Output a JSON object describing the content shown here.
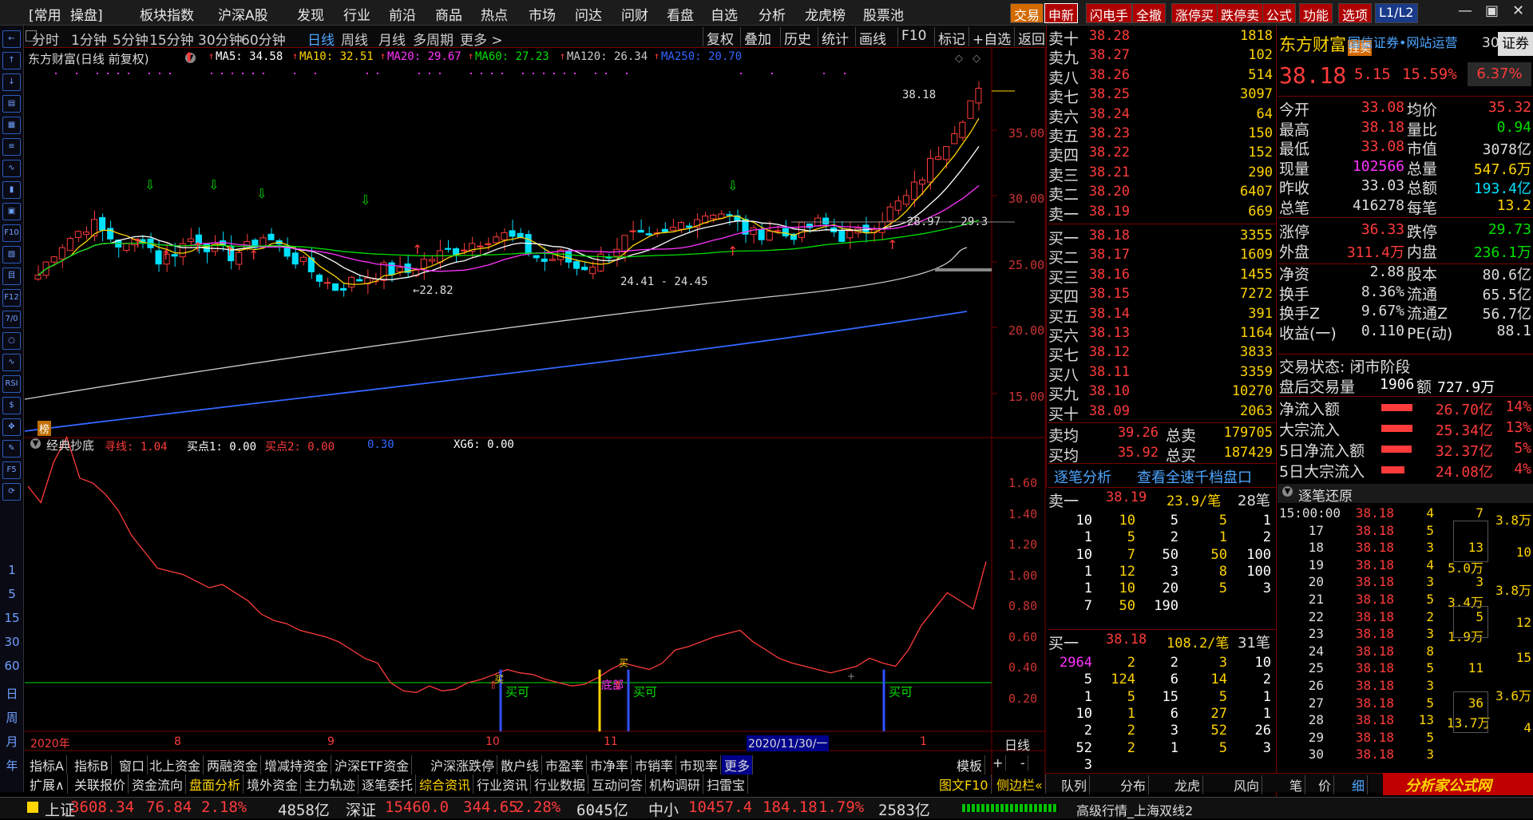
{
  "colors": {
    "up": "#ff3b3b",
    "down": "#00e0ff",
    "green": "#00e000",
    "yellow": "#ffd400",
    "magenta": "#ff33ff",
    "grid": "#7a0000"
  },
  "menu": {
    "items": [
      "[常用",
      "操盘]",
      "板块指数",
      "沪深A股",
      "发现",
      "行业",
      "前沿",
      "商品",
      "热点",
      "市场",
      "问达",
      "问财",
      "看盘",
      "自选",
      "分析",
      "龙虎榜",
      "股票池"
    ],
    "right_buttons": [
      "交易",
      "申新",
      "闪电手",
      "全撤",
      "涨停买",
      "跌停卖",
      "公式",
      "功能",
      "选项",
      "L1/L2"
    ]
  },
  "window_controls": [
    "—",
    "▣",
    "✕"
  ],
  "sidebar": {
    "icons": [
      "arrow-left-icon",
      "arrow-up-icon",
      "arrow-down-icon",
      "chart-icon",
      "grid-icon",
      "list-icon",
      "line-chart-icon",
      "candle-icon",
      "board-icon",
      "f10-icon",
      "doc-icon",
      "quote-icon",
      "f12-icon",
      "f6-icon",
      "circle-icon",
      "wave-icon",
      "rsi-icon",
      "money-icon",
      "move-icon",
      "pencil-icon",
      "f5-icon",
      "refresh-icon"
    ],
    "icon_labels": [
      "←",
      "↑",
      "↓",
      "▤",
      "▦",
      "≡",
      "∿",
      "▮",
      "▣",
      "F10",
      "▧",
      "目",
      "F12",
      "7/0",
      "○",
      "∿",
      "RSI",
      "$",
      "✥",
      "✎",
      "F5",
      "⟳"
    ],
    "numbers": [
      "1",
      "5",
      "15",
      "30",
      "60",
      "日",
      "周",
      "月",
      "年"
    ]
  },
  "toolbar": {
    "periods": [
      "分时",
      "1分钟",
      "5分钟",
      "15分钟",
      "30分钟",
      "60分钟",
      "日线",
      "周线",
      "月线",
      "多周期",
      "更多 >"
    ],
    "active": "日线",
    "tools": [
      "复权",
      "叠加",
      "历史",
      "统计",
      "画线",
      "F10",
      "标记",
      "+自选",
      "返回"
    ]
  },
  "stock": {
    "title": "东方财富(日线 前复权)",
    "name": "东方财富",
    "price": "38.18",
    "change": "5.15",
    "pct": "15.59%",
    "right_pct": "6.37%",
    "badge": "挂卖",
    "broker": "国信证券•网站运营",
    "code_prefix": "30",
    "tag": "证券",
    "rank_badge": "榜"
  },
  "ma_legend": [
    {
      "label": "MA5: 34.58",
      "color": "#ffffff"
    },
    {
      "label": "MA10: 32.51",
      "color": "#ffd400"
    },
    {
      "label": "MA20: 29.67",
      "color": "#ff33ff"
    },
    {
      "label": "MA60: 27.23",
      "color": "#00e000"
    },
    {
      "label": "MA120: 26.34",
      "color": "#cccccc"
    },
    {
      "label": "MA250: 20.70",
      "color": "#3366ff"
    }
  ],
  "price_axis": [
    "35.00",
    "30.00",
    "25.00",
    "20.00",
    "15.00"
  ],
  "annotations": {
    "high": "38.18",
    "range": "28.97 - 29.3",
    "low1": "←22.82",
    "low2": "24.41 - 24.45"
  },
  "indicator": {
    "name": "经典抄底",
    "legend": [
      {
        "label": "寻线: 1.04",
        "color": "#ff3b3b"
      },
      {
        "label": "买点1: 0.00",
        "color": "#ffffff"
      },
      {
        "label": "买点2: 0.00",
        "color": "#ff3b3b"
      },
      {
        "label": "0.30",
        "color": "#3366ff"
      },
      {
        "label": "XG6: 0.00",
        "color": "#ffffff"
      }
    ],
    "axis": [
      "1.60",
      "1.40",
      "1.20",
      "1.00",
      "0.80",
      "0.60",
      "0.40",
      "0.20"
    ],
    "signal": "买可",
    "signal2": "底部",
    "mark": "买"
  },
  "date_axis": {
    "labels": [
      "2020年",
      "8",
      "9",
      "10",
      "11",
      "2020/11/30/一",
      "1"
    ],
    "period": "日线"
  },
  "bottom_tabs1": [
    "指标A",
    "指标B",
    "窗口",
    "北上资金",
    "两融资金",
    "增减持资金",
    "沪深ETF资金",
    "沪深涨跌停",
    "散户线",
    "市盈率",
    "市净率",
    "市销率",
    "市现率",
    "更多"
  ],
  "bottom_tabs2": [
    "扩展∧",
    "关联报价",
    "资金流向",
    "盘面分析",
    "境外资金",
    "主力轨迹",
    "逐笔委托",
    "综合资讯",
    "行业资讯",
    "行业数据",
    "互动问答",
    "机构调研",
    "扫雷宝"
  ],
  "bottom_tabs_right": [
    "模板",
    "+",
    "-"
  ],
  "bottom_tabs2_right": [
    "图文F10",
    "侧边栏«"
  ],
  "order_book": {
    "sell": [
      {
        "l": "卖十",
        "p": "38.28",
        "v": "1818"
      },
      {
        "l": "卖九",
        "p": "38.27",
        "v": "102"
      },
      {
        "l": "卖八",
        "p": "38.26",
        "v": "514"
      },
      {
        "l": "卖七",
        "p": "38.25",
        "v": "3097"
      },
      {
        "l": "卖六",
        "p": "38.24",
        "v": "64"
      },
      {
        "l": "卖五",
        "p": "38.23",
        "v": "150"
      },
      {
        "l": "卖四",
        "p": "38.22",
        "v": "152"
      },
      {
        "l": "卖三",
        "p": "38.21",
        "v": "290"
      },
      {
        "l": "卖二",
        "p": "38.20",
        "v": "6407"
      },
      {
        "l": "卖一",
        "p": "38.19",
        "v": "669"
      }
    ],
    "buy": [
      {
        "l": "买一",
        "p": "38.18",
        "v": "3355"
      },
      {
        "l": "买二",
        "p": "38.17",
        "v": "1609"
      },
      {
        "l": "买三",
        "p": "38.16",
        "v": "1455"
      },
      {
        "l": "买四",
        "p": "38.15",
        "v": "7272"
      },
      {
        "l": "买五",
        "p": "38.14",
        "v": "391"
      },
      {
        "l": "买六",
        "p": "38.13",
        "v": "1164"
      },
      {
        "l": "买七",
        "p": "38.12",
        "v": "3833"
      },
      {
        "l": "买八",
        "p": "38.11",
        "v": "3359"
      },
      {
        "l": "买九",
        "p": "38.10",
        "v": "10270"
      },
      {
        "l": "买十",
        "p": "38.09",
        "v": "2063"
      }
    ],
    "avg": [
      {
        "l": "卖均",
        "p": "39.26",
        "l2": "总卖",
        "v": "179705"
      },
      {
        "l": "买均",
        "p": "35.92",
        "l2": "总买",
        "v": "187429"
      }
    ]
  },
  "tick_links": [
    "逐笔分析",
    "查看全速千档盘口"
  ],
  "queue_sell": {
    "label": "卖一",
    "price": "38.19",
    "avg": "23.9/笔",
    "count": "28笔",
    "rows": [
      [
        "10",
        "10",
        "5",
        "5",
        "1"
      ],
      [
        "1",
        "5",
        "2",
        "1",
        "2"
      ],
      [
        "10",
        "7",
        "50",
        "50",
        "100"
      ],
      [
        "1",
        "12",
        "3",
        "8",
        "100"
      ],
      [
        "1",
        "10",
        "20",
        "5",
        "3"
      ],
      [
        "7",
        "50",
        "190",
        "",
        ""
      ]
    ]
  },
  "queue_buy": {
    "label": "买一",
    "price": "38.18",
    "avg": "108.2/笔",
    "count": "31笔",
    "rows": [
      [
        "2964",
        "2",
        "2",
        "3",
        "10"
      ],
      [
        "5",
        "124",
        "6",
        "14",
        "2"
      ],
      [
        "1",
        "5",
        "15",
        "5",
        "1"
      ],
      [
        "10",
        "1",
        "6",
        "27",
        "1"
      ],
      [
        "2",
        "2",
        "3",
        "52",
        "26"
      ],
      [
        "52",
        "2",
        "1",
        "5",
        "3"
      ],
      [
        "3",
        "",
        "",
        "",
        ""
      ]
    ]
  },
  "quote": [
    {
      "l1": "今开",
      "v1": "33.08",
      "c1": "#ff3b3b",
      "l2": "均价",
      "v2": "35.32",
      "c2": "#ff3b3b"
    },
    {
      "l1": "最高",
      "v1": "38.18",
      "c1": "#ff3b3b",
      "l2": "量比",
      "v2": "0.94",
      "c2": "#00e000"
    },
    {
      "l1": "最低",
      "v1": "33.08",
      "c1": "#ff3b3b",
      "l2": "市值",
      "v2": "3078亿",
      "c2": "#ddd"
    },
    {
      "l1": "现量",
      "v1": "102566",
      "c1": "#ff33ff",
      "l2": "总量",
      "v2": "547.6万",
      "c2": "#ffd400"
    },
    {
      "l1": "昨收",
      "v1": "33.03",
      "c1": "#ddd",
      "l2": "总额",
      "v2": "193.4亿",
      "c2": "#00e0ff"
    },
    {
      "l1": "总笔",
      "v1": "416278",
      "c1": "#ddd",
      "l2": "每笔",
      "v2": "13.2",
      "c2": "#ffd400"
    },
    {
      "l1": "涨停",
      "v1": "36.33",
      "c1": "#ff3b3b",
      "l2": "跌停",
      "v2": "29.73",
      "c2": "#00e000"
    },
    {
      "l1": "外盘",
      "v1": "311.4万",
      "c1": "#ff3b3b",
      "l2": "内盘",
      "v2": "236.1万",
      "c2": "#00e000"
    },
    {
      "l1": "净资",
      "v1": "2.88",
      "c1": "#ddd",
      "l2": "股本",
      "v2": "80.6亿",
      "c2": "#ddd"
    },
    {
      "l1": "换手",
      "v1": "8.36%",
      "c1": "#ddd",
      "l2": "流通",
      "v2": "65.5亿",
      "c2": "#ddd"
    },
    {
      "l1": "换手Z",
      "v1": "9.67%",
      "c1": "#ddd",
      "l2": "流通Z",
      "v2": "56.7亿",
      "c2": "#ddd"
    },
    {
      "l1": "收益(一)",
      "v1": "0.110",
      "c1": "#ddd",
      "l2": "PE(动)",
      "v2": "88.1",
      "c2": "#ddd"
    }
  ],
  "trade_status": "交易状态: 闭市阶段",
  "after_hours": {
    "label": "盘后交易量",
    "vol": "1906",
    "amt_label": "额",
    "amt": "727.9万"
  },
  "flows": [
    {
      "l": "净流入额",
      "v": "26.70亿",
      "p": "14%"
    },
    {
      "l": "大宗流入",
      "v": "25.34亿",
      "p": "13%"
    },
    {
      "l": "5日净流入额",
      "v": "32.37亿",
      "p": "5%"
    },
    {
      "l": "5日大宗流入",
      "v": "24.08亿",
      "p": "4%"
    }
  ],
  "ticks_title": "逐笔还原",
  "ticks": [
    {
      "t": "15:00:00",
      "p": "38.18",
      "n": "4",
      "s": "7"
    },
    {
      "t": "17",
      "p": "38.18",
      "n": "5",
      "s": ""
    },
    {
      "t": "18",
      "p": "38.18",
      "n": "3",
      "s": "13"
    },
    {
      "t": "19",
      "p": "38.18",
      "n": "4",
      "s": "5.0万"
    },
    {
      "t": "20",
      "p": "38.18",
      "n": "3",
      "s": "3"
    },
    {
      "t": "21",
      "p": "38.18",
      "n": "5",
      "s": "3.4万"
    },
    {
      "t": "22",
      "p": "38.18",
      "n": "2",
      "s": "5"
    },
    {
      "t": "23",
      "p": "38.18",
      "n": "3",
      "s": "1.9万"
    },
    {
      "t": "24",
      "p": "38.18",
      "n": "8",
      "s": ""
    },
    {
      "t": "25",
      "p": "38.18",
      "n": "5",
      "s": "11"
    },
    {
      "t": "26",
      "p": "38.18",
      "n": "3",
      "s": ""
    },
    {
      "t": "27",
      "p": "38.18",
      "n": "5",
      "s": "36"
    },
    {
      "t": "28",
      "p": "38.18",
      "n": "13",
      "s": "13.7万"
    },
    {
      "t": "29",
      "p": "38.18",
      "n": "5",
      "s": ""
    },
    {
      "t": "30",
      "p": "38.18",
      "n": "3",
      "s": ""
    }
  ],
  "tick_right": [
    "3.8万",
    "10",
    "3.8万",
    "12",
    "15",
    "3.6万",
    "4"
  ],
  "right_bottom_tabs": [
    "队列",
    "分布",
    "龙虎",
    "风向",
    "笔",
    "价",
    "细"
  ],
  "status": {
    "sh_label": "上证",
    "sh": "3608.34",
    "sh_chg": "76.84",
    "sh_pct": "2.18%",
    "sh_amt": "4858亿",
    "sz_label": "深证",
    "sz": "15460.0",
    "sz_chg": "344.65",
    "sz_pct": "2.28%",
    "sz_amt": "6045亿",
    "zx_label": "中小",
    "zx": "10457.4",
    "zx_chg": "184.18",
    "zx_pct": "1.79%",
    "zx_amt": "2583亿",
    "feed": "高级行情_上海双线2",
    "watermark": "分析家公式网",
    "watermark_url": "www.70822.com"
  },
  "chart_data": {
    "type": "line",
    "ma_lines": [
      "#ffd400",
      "#ffffff",
      "#ff33ff",
      "#00e000",
      "#cccccc",
      "#3366ff"
    ],
    "indicator_values": [
      1.5,
      1.4,
      1.65,
      1.8,
      1.55,
      1.52,
      1.45,
      1.35,
      1.2,
      1.1,
      1.0,
      0.98,
      0.96,
      0.92,
      0.88,
      0.9,
      0.85,
      0.8,
      0.72,
      0.68,
      0.66,
      0.62,
      0.6,
      0.58,
      0.55,
      0.5,
      0.45,
      0.42,
      0.3,
      0.25,
      0.24,
      0.28,
      0.25,
      0.26,
      0.3,
      0.32,
      0.35,
      0.38,
      0.36,
      0.35,
      0.32,
      0.3,
      0.28,
      0.29,
      0.33,
      0.38,
      0.42,
      0.4,
      0.38,
      0.42,
      0.5,
      0.52,
      0.55,
      0.58,
      0.6,
      0.62,
      0.55,
      0.5,
      0.45,
      0.42,
      0.4,
      0.38,
      0.36,
      0.38,
      0.4,
      0.45,
      0.42,
      0.4,
      0.5,
      0.65,
      0.75,
      0.85,
      0.8,
      0.75,
      1.04
    ],
    "indicator_ylim": [
      0.1,
      1.7
    ],
    "baseline": 0.3
  }
}
